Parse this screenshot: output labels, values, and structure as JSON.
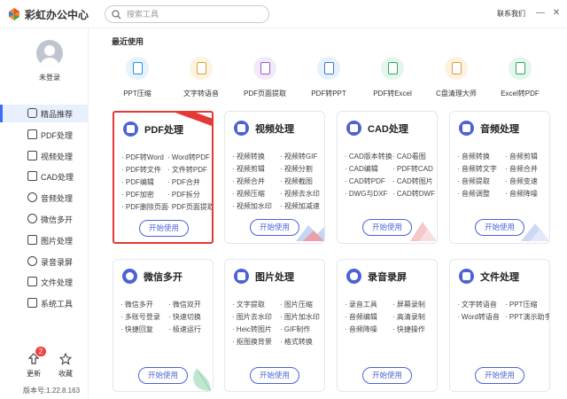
{
  "app": {
    "title": "彩虹办公中心",
    "contact": "联系我们"
  },
  "search": {
    "placeholder": "搜索工具"
  },
  "sidebar": {
    "login": "未登录",
    "items": [
      {
        "label": "精品推荐",
        "active": true
      },
      {
        "label": "PDF处理"
      },
      {
        "label": "视频处理"
      },
      {
        "label": "CAD处理"
      },
      {
        "label": "音频处理"
      },
      {
        "label": "微信多开"
      },
      {
        "label": "图片处理"
      },
      {
        "label": "录音录屏"
      },
      {
        "label": "文件处理"
      },
      {
        "label": "系统工具"
      }
    ],
    "update_label": "更新",
    "update_badge": "2",
    "favorite_label": "收藏",
    "version": "版本号:1.22.8.163"
  },
  "main": {
    "recent_title": "最近使用",
    "recent": [
      {
        "label": "PPT压缩",
        "color": "#e6f3fd",
        "accent": "#2f8fe0"
      },
      {
        "label": "文字转语音",
        "color": "#fdf3e1",
        "accent": "#e0a12f"
      },
      {
        "label": "PDF页面提取",
        "color": "#f2eaf8",
        "accent": "#9a5ad0"
      },
      {
        "label": "PDF转PPT",
        "color": "#e6f1fc",
        "accent": "#3a78d6"
      },
      {
        "label": "PDF转Excel",
        "color": "#e5f6ec",
        "accent": "#2faa5d"
      },
      {
        "label": "C盘清理大师",
        "color": "#fdf1e2",
        "accent": "#e29a3a"
      },
      {
        "label": "Excel转PDF",
        "color": "#e5f6ec",
        "accent": "#2faa5d"
      }
    ],
    "start_label": "开始使用",
    "cards": [
      {
        "title": "PDF处理",
        "color": "#4b63d6",
        "features": [
          "PDF转Word",
          "Word转PDF",
          "PDF转文件",
          "文件转PDF",
          "PDF编辑",
          "PDF合并",
          "PDF加密",
          "PDF拆分",
          "PDF删除页面",
          "PDF页面提取"
        ]
      },
      {
        "title": "视频处理",
        "color": "#4b63d6",
        "features": [
          "视频转换",
          "视频转GIF",
          "视频剪辑",
          "视频分割",
          "视频合并",
          "视频截图",
          "视频压缩",
          "视频去水印",
          "视频加水印",
          "视频加减速"
        ]
      },
      {
        "title": "CAD处理",
        "color": "#4b63d6",
        "features": [
          "CAD版本转换",
          "CAD看图",
          "CAD编辑",
          "PDF转CAD",
          "CAD转PDF",
          "CAD转图片",
          "DWG与DXF",
          "CAD转DWF"
        ]
      },
      {
        "title": "音频处理",
        "color": "#4b63d6",
        "features": [
          "音频转换",
          "音频剪辑",
          "音频转文字",
          "音频合并",
          "音频提取",
          "音频变速",
          "音频调整",
          "音频降噪"
        ]
      },
      {
        "title": "微信多开",
        "color": "#4b63d6",
        "features": [
          "微信多开",
          "微信双开",
          "多账号登录",
          "快速切换",
          "快捷回复",
          "极速运行"
        ]
      },
      {
        "title": "图片处理",
        "color": "#4b63d6",
        "features": [
          "文字提取",
          "图片压缩",
          "图片去水印",
          "图片加水印",
          "Heic转图片",
          "GIF制作",
          "抠图换背景",
          "格式转换"
        ]
      },
      {
        "title": "录音录屏",
        "color": "#4b63d6",
        "features": [
          "录音工具",
          "屏幕录制",
          "音频编辑",
          "高清录制",
          "音频降噪",
          "快捷操作"
        ]
      },
      {
        "title": "文件处理",
        "color": "#4b63d6",
        "features": [
          "文字转语音",
          "PPT压缩",
          "Word转语音",
          "PPT演示助手"
        ]
      }
    ]
  }
}
